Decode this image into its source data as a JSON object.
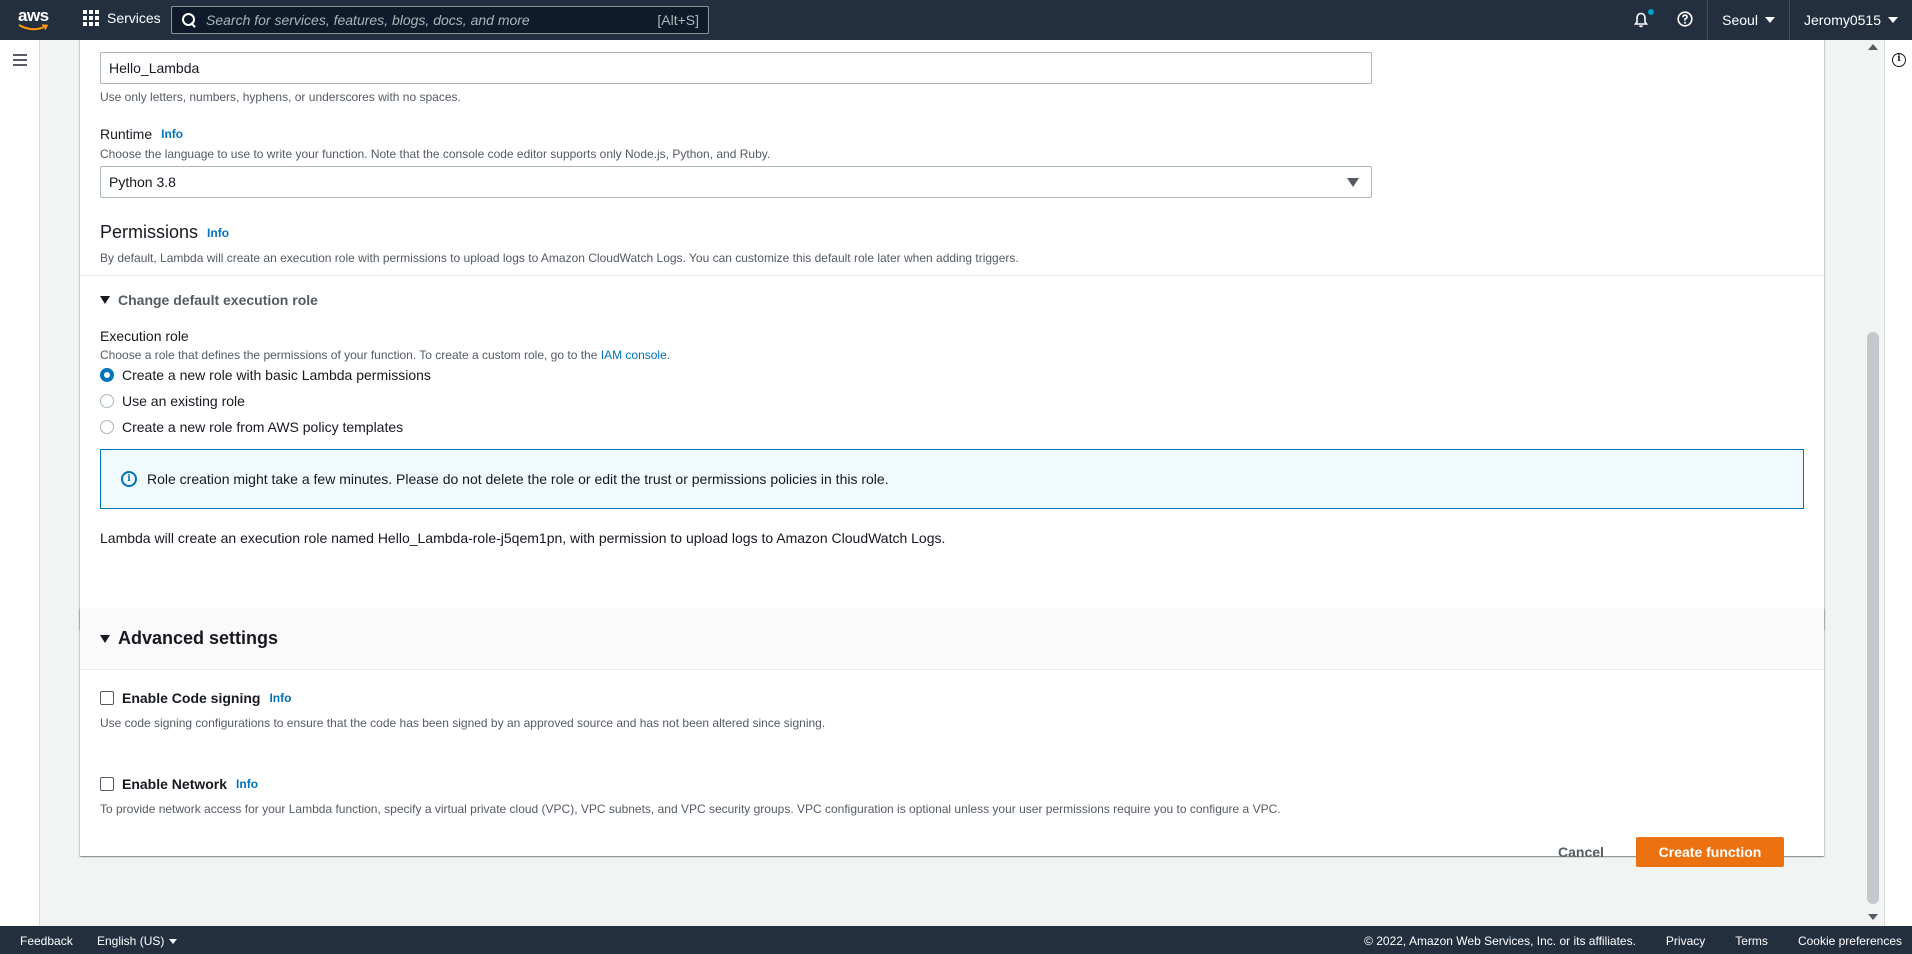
{
  "topnav": {
    "logo_text": "aws",
    "services_label": "Services",
    "search_placeholder": "Search for services, features, blogs, docs, and more",
    "search_shortcut": "[Alt+S]",
    "region": "Seoul",
    "account": "Jeromy0515"
  },
  "form": {
    "function_name_value": "Hello_Lambda",
    "function_name_hint": "Use only letters, numbers, hyphens, or underscores with no spaces.",
    "runtime_label": "Runtime",
    "info": "Info",
    "runtime_desc": "Choose the language to use to write your function. Note that the console code editor supports only Node.js, Python, and Ruby.",
    "runtime_value": "Python 3.8"
  },
  "permissions": {
    "title": "Permissions",
    "desc": "By default, Lambda will create an execution role with permissions to upload logs to Amazon CloudWatch Logs. You can customize this default role later when adding triggers.",
    "expand_label": "Change default execution role",
    "role_label": "Execution role",
    "role_desc": "Choose a role that defines the permissions of your function. To create a custom role, go to the",
    "role_link": "IAM console",
    "role_desc_end": ".",
    "options": [
      "Create a new role with basic Lambda permissions",
      "Use an existing role",
      "Create a new role from AWS policy templates"
    ],
    "alert": "Role creation might take a few minutes. Please do not delete the role or edit the trust or permissions policies in this role.",
    "summary": "Lambda will create an execution role named Hello_Lambda-role-j5qem1pn, with permission to upload logs to Amazon CloudWatch Logs."
  },
  "advanced": {
    "title": "Advanced settings",
    "code_signing_label": "Enable Code signing",
    "code_signing_desc": "Use code signing configurations to ensure that the code has been signed by an approved source and has not been altered since signing.",
    "network_label": "Enable Network",
    "network_desc": "To provide network access for your Lambda function, specify a virtual private cloud (VPC), VPC subnets, and VPC security groups. VPC configuration is optional unless your user permissions require you to configure a VPC."
  },
  "actions": {
    "cancel": "Cancel",
    "create": "Create function"
  },
  "footer": {
    "feedback": "Feedback",
    "language": "English (US)",
    "copyright": "© 2022, Amazon Web Services, Inc. or its affiliates.",
    "privacy": "Privacy",
    "terms": "Terms",
    "cookies": "Cookie preferences"
  },
  "colors": {
    "nav_bg": "#232f3e",
    "link": "#0073bb",
    "primary": "#ec7211"
  }
}
